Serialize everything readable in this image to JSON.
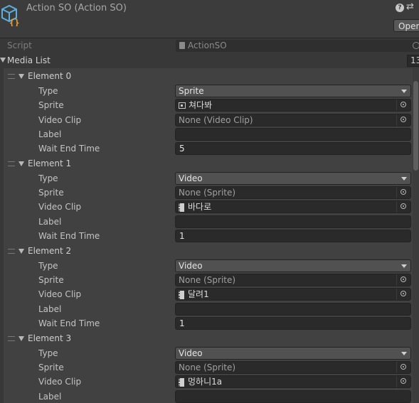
{
  "header": {
    "title": "Action SO (Action SO)",
    "help_icon": "help-icon",
    "preset_icon": "presets-icon",
    "open_label": "Open"
  },
  "script_row": {
    "label": "Script",
    "value": "ActionSO"
  },
  "media_list": {
    "label": "Media List",
    "count": "13"
  },
  "field_labels": {
    "type": "Type",
    "sprite": "Sprite",
    "video_clip": "Video Clip",
    "label": "Label",
    "wait_end_time": "Wait End Time"
  },
  "elements": [
    {
      "title": "Element 0",
      "type": "Sprite",
      "sprite": "쳐다봐",
      "video_clip": "None (Video Clip)",
      "label": "",
      "wait_end_time": "5"
    },
    {
      "title": "Element 1",
      "type": "Video",
      "sprite": "None (Sprite)",
      "video_clip": "바다로",
      "label": "",
      "wait_end_time": "1"
    },
    {
      "title": "Element 2",
      "type": "Video",
      "sprite": "None (Sprite)",
      "video_clip": "달려1",
      "label": "",
      "wait_end_time": "1"
    },
    {
      "title": "Element 3",
      "type": "Video",
      "sprite": "None (Sprite)",
      "video_clip": "멍하니1a",
      "label": ""
    }
  ],
  "colors": {
    "background": "#383838",
    "list_background": "#414141",
    "field_background": "#2a2a2a",
    "dropdown_background": "#515151",
    "text": "#c4c4c4",
    "asset_icon": "#5cb0e0",
    "asset_icon_badge": "#f0a030"
  }
}
